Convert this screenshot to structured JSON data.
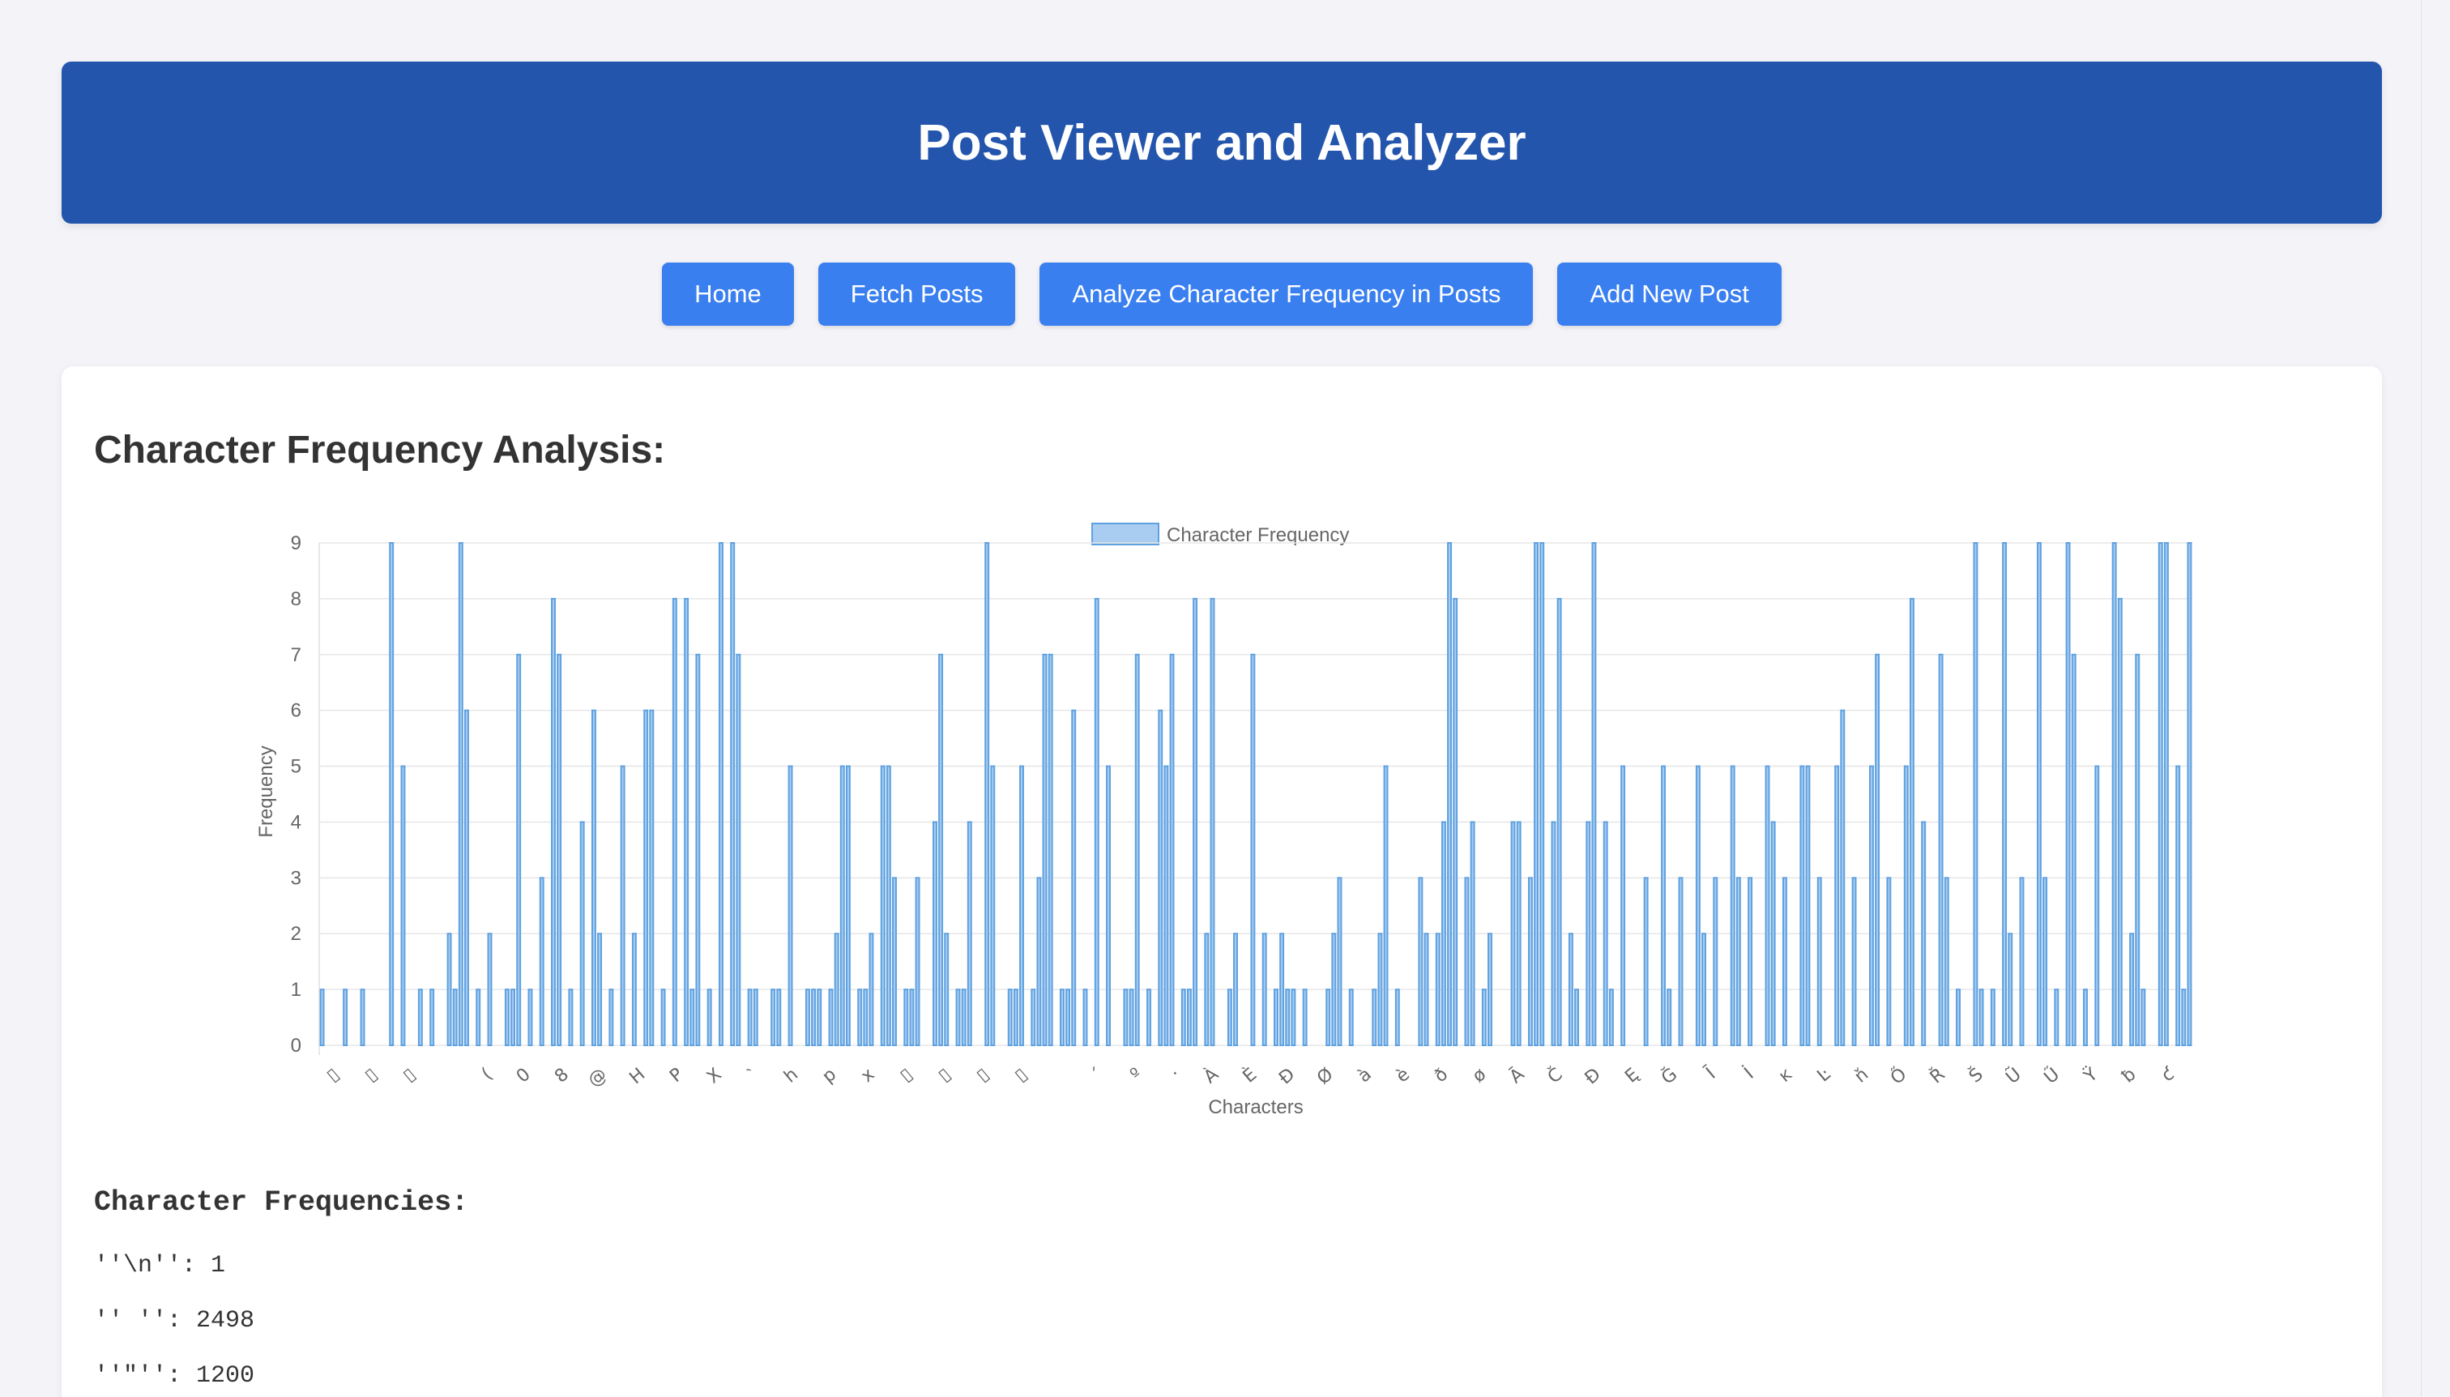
{
  "header": {
    "title": "Post Viewer and Analyzer"
  },
  "nav": {
    "buttons": [
      "Home",
      "Fetch Posts",
      "Analyze Character Frequency in Posts",
      "Add New Post"
    ]
  },
  "main": {
    "heading": "Character Frequency Analysis:",
    "frequencies_title": "Character Frequencies:",
    "frequencies": [
      "''\\n'': 1",
      "'' '': 2498",
      "''\"'': 1200"
    ]
  },
  "colors": {
    "header_bg": "#2455ac",
    "button_bg": "#3a7ff0",
    "bar_fill": "#a9cdf1",
    "bar_stroke": "#5ea1e0"
  },
  "chart_data": {
    "type": "bar",
    "legend": "Character Frequency",
    "legend_position": "top-center",
    "xlabel": "Characters",
    "ylabel": "Frequency",
    "ylim": [
      0,
      9
    ],
    "yticks": [
      0,
      1,
      2,
      3,
      4,
      5,
      6,
      7,
      8,
      9
    ],
    "grid": true,
    "x_tick_labels": [
      "▯",
      "▯",
      "▯",
      "",
      "(",
      "0",
      "8",
      "@",
      "H",
      "P",
      "X",
      "`",
      "h",
      "p",
      "x",
      "▯",
      "▯",
      "▯",
      "▯",
      "",
      "´",
      "º",
      "·",
      "À",
      "È",
      "Ð",
      "Ø",
      "à",
      "è",
      "ð",
      "ø",
      "Ā",
      "Č",
      "Đ",
      "Ę",
      "Ğ",
      "Ī",
      "İ",
      "ĸ",
      "Ŀ",
      "ň",
      "Ő",
      "Ř",
      "Š",
      "Ũ",
      "Ű",
      "Ÿ",
      "ƀ",
      "ƈ"
    ],
    "values": [
      1,
      0,
      0,
      0,
      1,
      0,
      0,
      1,
      0,
      0,
      0,
      0,
      9,
      0,
      5,
      0,
      0,
      1,
      0,
      1,
      0,
      0,
      2,
      1,
      9,
      6,
      0,
      1,
      0,
      2,
      0,
      0,
      1,
      1,
      7,
      0,
      1,
      0,
      3,
      0,
      8,
      7,
      0,
      1,
      0,
      4,
      0,
      6,
      2,
      0,
      1,
      0,
      5,
      0,
      2,
      0,
      6,
      6,
      0,
      1,
      0,
      8,
      0,
      8,
      1,
      7,
      0,
      1,
      0,
      9,
      0,
      9,
      7,
      0,
      1,
      1,
      0,
      0,
      1,
      1,
      0,
      5,
      0,
      0,
      1,
      1,
      1,
      0,
      1,
      2,
      5,
      5,
      0,
      1,
      1,
      2,
      0,
      5,
      5,
      3,
      0,
      1,
      1,
      3,
      0,
      0,
      4,
      7,
      2,
      0,
      1,
      1,
      4,
      0,
      0,
      9,
      5,
      0,
      0,
      1,
      1,
      5,
      0,
      1,
      3,
      7,
      7,
      0,
      1,
      1,
      6,
      0,
      1,
      0,
      8,
      0,
      5,
      0,
      0,
      1,
      1,
      7,
      0,
      1,
      0,
      6,
      5,
      7,
      0,
      1,
      1,
      8,
      0,
      2,
      8,
      0,
      0,
      1,
      2,
      0,
      0,
      7,
      0,
      2,
      0,
      1,
      2,
      1,
      1,
      0,
      1,
      0,
      0,
      0,
      1,
      2,
      3,
      0,
      1,
      0,
      0,
      0,
      1,
      2,
      5,
      0,
      1,
      0,
      0,
      0,
      3,
      2,
      0,
      2,
      4,
      9,
      8,
      0,
      3,
      4,
      0,
      1,
      2,
      0,
      0,
      0,
      4,
      4,
      0,
      3,
      9,
      9,
      0,
      4,
      8,
      0,
      2,
      1,
      0,
      4,
      9,
      0,
      4,
      1,
      0,
      5,
      0,
      0,
      0,
      3,
      0,
      0,
      5,
      1,
      0,
      3,
      0,
      0,
      5,
      2,
      0,
      3,
      0,
      0,
      5,
      3,
      0,
      3,
      0,
      0,
      5,
      4,
      0,
      3,
      0,
      0,
      5,
      5,
      0,
      3,
      0,
      0,
      5,
      6,
      0,
      3,
      0,
      0,
      5,
      7,
      0,
      3,
      0,
      0,
      5,
      8,
      0,
      4,
      0,
      0,
      7,
      3,
      0,
      1,
      0,
      0,
      9,
      1,
      0,
      1,
      0,
      9,
      2,
      0,
      3,
      0,
      0,
      9,
      3,
      0,
      1,
      0,
      9,
      7,
      0,
      1,
      0,
      5,
      0,
      0,
      9,
      8,
      0,
      2,
      7,
      1,
      0,
      0,
      9,
      9,
      0,
      5,
      1,
      9
    ]
  }
}
